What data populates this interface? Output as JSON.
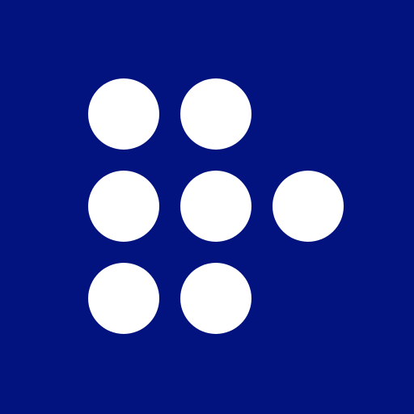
{
  "logo": {
    "icon": "dot-grid-arrow-icon",
    "colors": {
      "background": "#02127f",
      "dot": "#ffffff"
    },
    "pattern": [
      [
        1,
        1,
        0
      ],
      [
        1,
        1,
        1
      ],
      [
        1,
        1,
        0
      ]
    ]
  }
}
